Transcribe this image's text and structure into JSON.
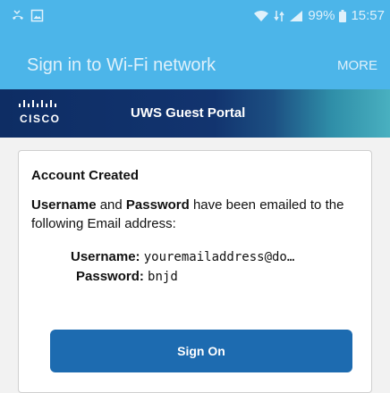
{
  "status_bar": {
    "battery_percent": "99%",
    "time": "15:57",
    "icons": [
      "missed-call-icon",
      "gallery-icon",
      "wifi-icon",
      "mobile-data-icon",
      "signal-icon",
      "battery-icon"
    ]
  },
  "appbar": {
    "title": "Sign in to Wi-Fi network",
    "more_label": "MORE"
  },
  "portal": {
    "logo_text": "CISCO",
    "title": "UWS Guest Portal",
    "brand_color": "#12346f"
  },
  "card": {
    "heading": "Account Created",
    "message_username": "Username",
    "message_and": " and ",
    "message_password": "Password",
    "message_rest": " have been emailed to the following Email address:",
    "username_label": "Username:",
    "username_value": "youremailaddress@do…",
    "password_label": "Password:",
    "password_value": "bnjd",
    "sign_on_label": "Sign On"
  },
  "colors": {
    "accent": "#4cb5e9",
    "button": "#1d6bb0"
  }
}
